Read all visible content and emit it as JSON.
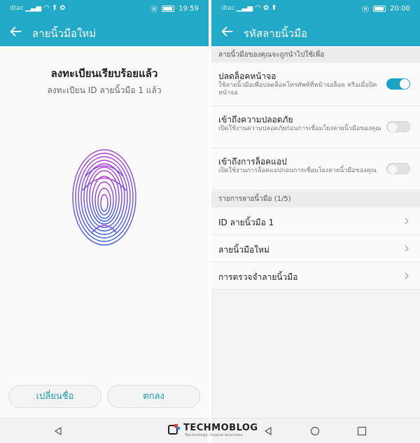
{
  "left": {
    "status": {
      "carrier": "dtac",
      "time": "19:59"
    },
    "appbar": {
      "title": "ลายนิ้วมือใหม่"
    },
    "content": {
      "title": "ลงทะเบียนเรียบร้อยแล้ว",
      "subtitle": "ลงทะเบียน ID ลายนิ้วมือ 1 แล้ว"
    },
    "buttons": {
      "rename": "เปลี่ยนชื่อ",
      "ok": "ตกลง"
    }
  },
  "right": {
    "status": {
      "carrier": "dtac",
      "time": "20:00"
    },
    "appbar": {
      "title": "รหัสลายนิ้วมือ"
    },
    "section1": {
      "header": "ลายนิ้วมือของคุณจะถูกนำไปใช้เพื่อ",
      "items": [
        {
          "title": "ปลดล็อคหน้าจอ",
          "desc": "ใช้ลายนิ้วมือเพื่อปลดล็อคโทรศัพท์ที่หน้าจอล็อค หรือเมื่อปิดหน้าจอ",
          "enabled": true
        },
        {
          "title": "เข้าถึงความปลอดภัย",
          "desc": "เปิดใช้งานความปลอดภัยก่อนการเชื่อมโยงลายนิ้วมือของคุณ",
          "enabled": false
        },
        {
          "title": "เข้าถึงการล็อคแอป",
          "desc": "เปิดใช้งานการล็อคแอปก่อนการเชื่อมโยงลายนิ้วมือของคุณ",
          "enabled": false
        }
      ]
    },
    "section2": {
      "header": "รายการลายนิ้วมือ (1/5)",
      "items": [
        {
          "title": "ID ลายนิ้วมือ 1"
        },
        {
          "title": "ลายนิ้วมือใหม่"
        },
        {
          "title": "การตรวจจำลายนิ้วมือ"
        }
      ]
    }
  },
  "watermark": {
    "brand": "TECHMOBLOG",
    "tagline": "Technology inspire business"
  },
  "colors": {
    "accent": "#22a9c7",
    "toggle_on": "#1aa3c3",
    "button_text": "#1a9ab8"
  },
  "battery_level": 0.85
}
